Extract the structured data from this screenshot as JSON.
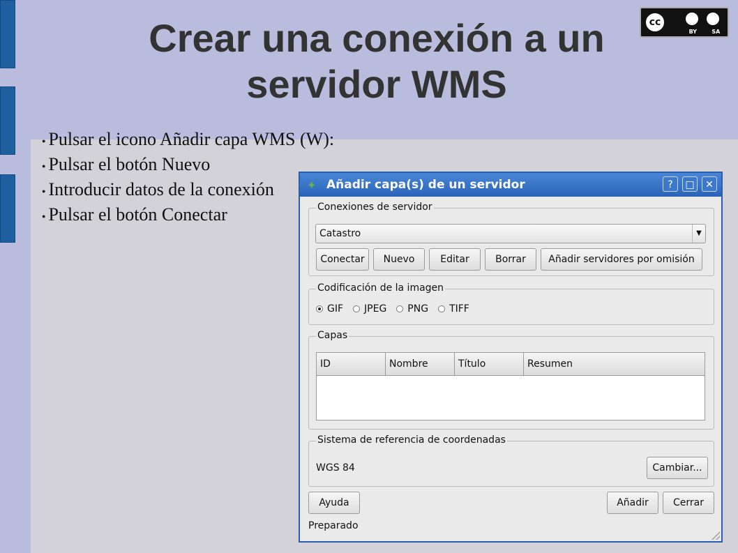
{
  "slide": {
    "title": "Crear una conexión a un servidor WMS",
    "license": {
      "icon": "cc-by-sa-icon",
      "by": "BY",
      "sa": "SA"
    },
    "bullets": [
      "Pulsar el icono Añadir capa WMS (W):",
      "Pulsar el botón Nuevo",
      "Introducir datos de la conexión",
      "Pulsar el botón Conectar"
    ]
  },
  "dialog": {
    "title": "Añadir capa(s) de un servidor",
    "titlebar_buttons": {
      "help": "?",
      "maximize": "□",
      "close": "✕"
    },
    "connections": {
      "label": "Conexiones de servidor",
      "selected": "Catastro",
      "buttons": {
        "connect": "Conectar",
        "new": "Nuevo",
        "edit": "Editar",
        "delete": "Borrar",
        "add_default": "Añadir servidores por omisión"
      }
    },
    "encoding": {
      "label": "Codificación de la imagen",
      "options": [
        "GIF",
        "JPEG",
        "PNG",
        "TIFF"
      ],
      "selected": "GIF"
    },
    "layers": {
      "label": "Capas",
      "columns": [
        "ID",
        "Nombre",
        "Título",
        "Resumen"
      ]
    },
    "crs": {
      "label": "Sistema de referencia de coordenadas",
      "value": "WGS 84",
      "change_button": "Cambiar..."
    },
    "buttons": {
      "help": "Ayuda",
      "add": "Añadir",
      "close": "Cerrar"
    },
    "status": "Preparado"
  }
}
